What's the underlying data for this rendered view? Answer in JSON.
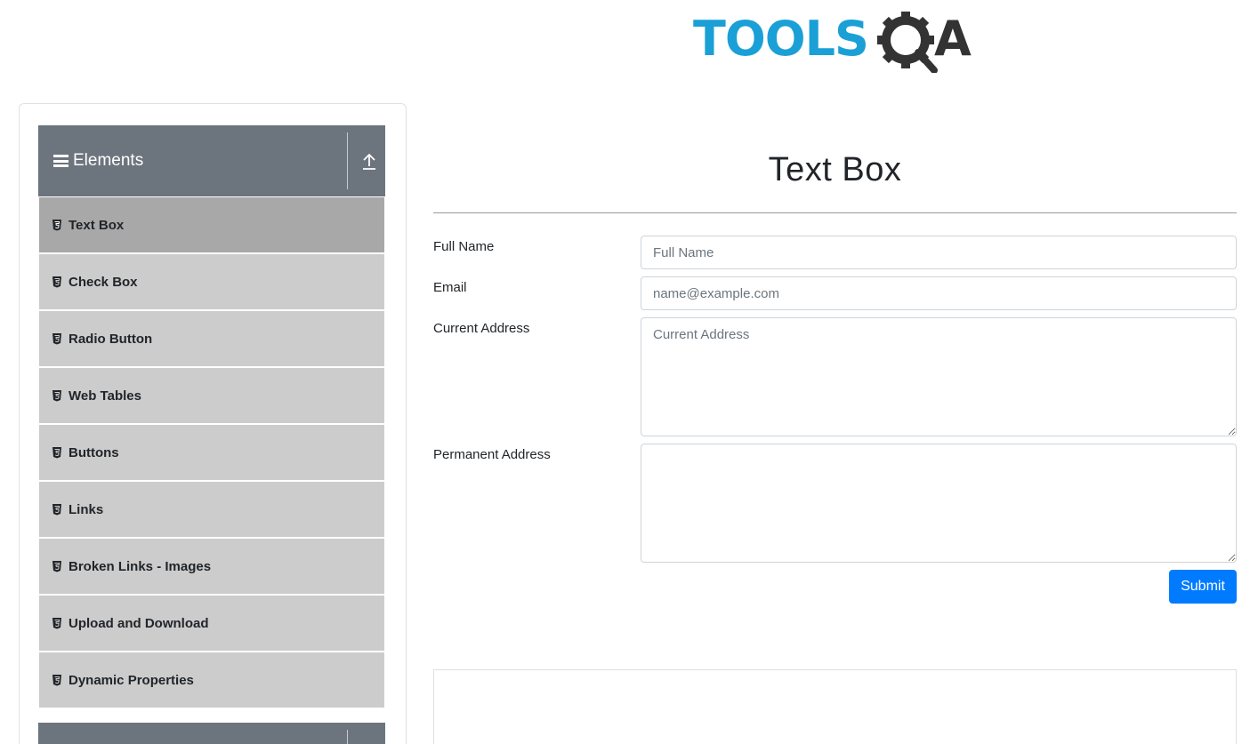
{
  "logo": {
    "part1": "TOOLS",
    "part2": "A"
  },
  "sidebar": {
    "group_title": "Elements",
    "items": [
      {
        "label": "Text Box",
        "active": true
      },
      {
        "label": "Check Box"
      },
      {
        "label": "Radio Button"
      },
      {
        "label": "Web Tables"
      },
      {
        "label": "Buttons"
      },
      {
        "label": "Links"
      },
      {
        "label": "Broken Links - Images"
      },
      {
        "label": "Upload and Download"
      },
      {
        "label": "Dynamic Properties"
      }
    ]
  },
  "main": {
    "title": "Text Box",
    "form": {
      "full_name": {
        "label": "Full Name",
        "placeholder": "Full Name",
        "value": ""
      },
      "email": {
        "label": "Email",
        "placeholder": "name@example.com",
        "value": ""
      },
      "current_address": {
        "label": "Current Address",
        "placeholder": "Current Address",
        "value": ""
      },
      "permanent_address": {
        "label": "Permanent Address",
        "placeholder": "",
        "value": ""
      },
      "submit_label": "Submit"
    }
  },
  "colors": {
    "brand_blue": "#1aa0d6",
    "header_gray": "#6c757d",
    "item_gray": "#cccccc",
    "item_active": "#a8a8a8",
    "submit_blue": "#007bff"
  }
}
